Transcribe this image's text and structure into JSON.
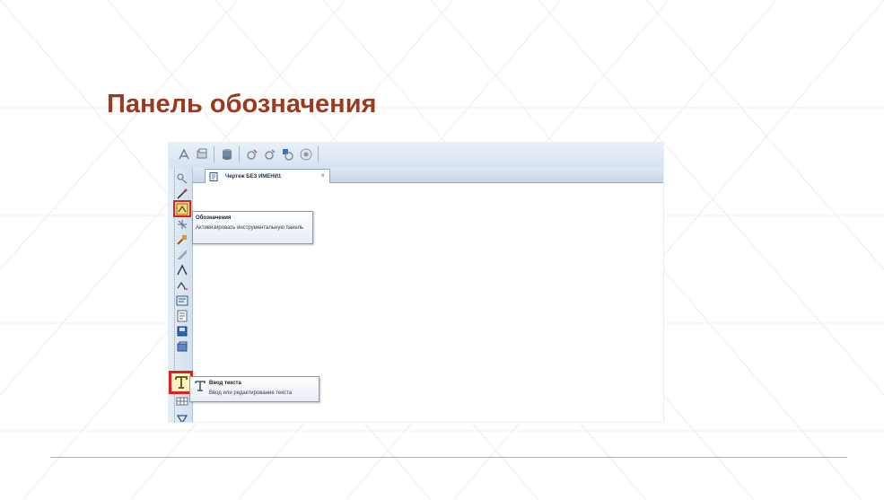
{
  "slide": {
    "title": "Панель обозначения"
  },
  "document_tab": {
    "label": "Чертеж БЕЗ ИМЕНИ1",
    "close_glyph": "×"
  },
  "tooltips": {
    "designations": {
      "title": "Обозначения",
      "description": "Активизировать инструментальную панель"
    },
    "text_input": {
      "title": "Ввод текста",
      "description": "Ввод или редактирование текста"
    }
  },
  "icons": {
    "top_toolbar": [
      "pointer-icon",
      "layers-icon",
      "database-icon",
      "spec-icon",
      "spec-copy-icon",
      "spec-link-icon",
      "settings-icon"
    ],
    "left_toolbar": [
      "geometry-icon",
      "dimensions-icon",
      "designations-icon",
      "edit-icon",
      "parametrization-icon",
      "measure-icon",
      "select-icon",
      "associative-icon",
      "spec-icon",
      "reports-icon",
      "insert-icon",
      "library-icon",
      "text-icon",
      "table-icon",
      "roughness-icon",
      "base-icon"
    ]
  },
  "colors": {
    "title": "#9b3a1e",
    "highlight": "#e02020",
    "footer_line": "#d9a48e"
  }
}
